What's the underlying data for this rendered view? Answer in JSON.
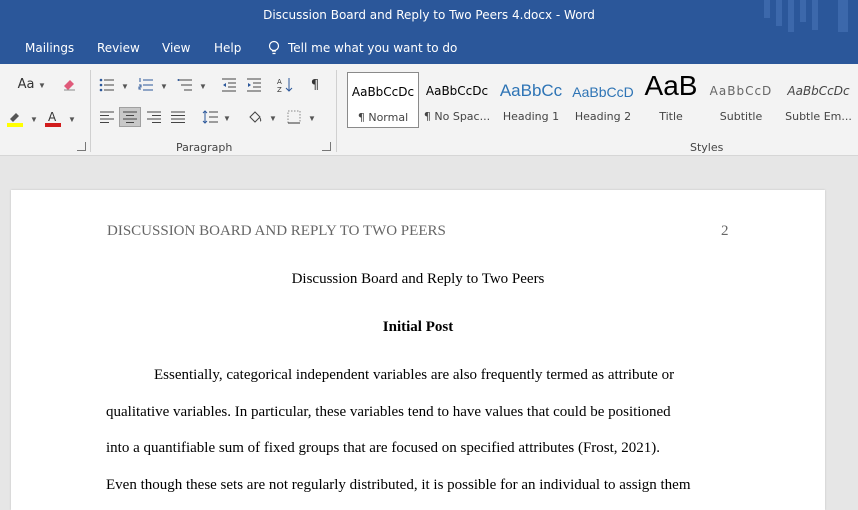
{
  "window": {
    "title": "Discussion Board and Reply to Two Peers 4.docx  -  Word"
  },
  "tabs": [
    "Mailings",
    "Review",
    "View",
    "Help"
  ],
  "tell_me": "Tell me what you want to do",
  "ribbon": {
    "font_change_case": "Aa",
    "paragraph_label": "Paragraph",
    "styles_label": "Styles",
    "styles": [
      {
        "preview": "AaBbCcDc",
        "name": "¶ Normal"
      },
      {
        "preview": "AaBbCcDc",
        "name": "¶ No Spac..."
      },
      {
        "preview": "AaBbCc",
        "name": "Heading 1"
      },
      {
        "preview": "AaBbCcD",
        "name": "Heading 2"
      },
      {
        "preview": "AaB",
        "name": "Title"
      },
      {
        "preview": "AaBbCcD",
        "name": "Subtitle"
      },
      {
        "preview": "AaBbCcDc",
        "name": "Subtle Em..."
      }
    ]
  },
  "document": {
    "running_head": "DISCUSSION BOARD AND REPLY TO TWO PEERS",
    "page_number": "2",
    "title": "Discussion Board and Reply to Two Peers",
    "heading": "Initial Post",
    "lines": [
      "Essentially, categorical independent variables are also frequently termed as attribute or",
      "qualitative variables. In particular, these variables tend to have values that could be positioned",
      "into a quantifiable sum of fixed groups that are focused on specified attributes (Frost, 2021).",
      "Even though these sets are not regularly distributed, it is possible for an individual to assign them"
    ]
  }
}
